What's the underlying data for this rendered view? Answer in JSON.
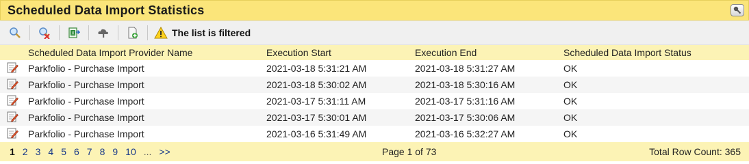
{
  "title": "Scheduled Data Import Statistics",
  "toolbar": {
    "filter_notice": "The list is filtered"
  },
  "columns": [
    "Scheduled Data Import Provider Name",
    "Execution Start",
    "Execution End",
    "Scheduled Data Import Status"
  ],
  "rows": [
    {
      "provider": "Parkfolio - Purchase Import",
      "start": "2021-03-18 5:31:21 AM",
      "end": "2021-03-18 5:31:27 AM",
      "status": "OK"
    },
    {
      "provider": "Parkfolio - Purchase Import",
      "start": "2021-03-18 5:30:02 AM",
      "end": "2021-03-18 5:30:16 AM",
      "status": "OK"
    },
    {
      "provider": "Parkfolio - Purchase Import",
      "start": "2021-03-17 5:31:11 AM",
      "end": "2021-03-17 5:31:16 AM",
      "status": "OK"
    },
    {
      "provider": "Parkfolio - Purchase Import",
      "start": "2021-03-17 5:30:01 AM",
      "end": "2021-03-17 5:30:06 AM",
      "status": "OK"
    },
    {
      "provider": "Parkfolio - Purchase Import",
      "start": "2021-03-16 5:31:49 AM",
      "end": "2021-03-16 5:32:27 AM",
      "status": "OK"
    }
  ],
  "pager": {
    "pages": [
      "1",
      "2",
      "3",
      "4",
      "5",
      "6",
      "7",
      "8",
      "9",
      "10"
    ],
    "ellipsis": "...",
    "next": ">>",
    "page_info": "Page 1 of 73",
    "total": "Total Row Count: 365"
  },
  "colors": {
    "title_bg": "#fbe57a",
    "header_bg": "#fcf3b5",
    "toolbar_bg": "#f0f0f0"
  }
}
